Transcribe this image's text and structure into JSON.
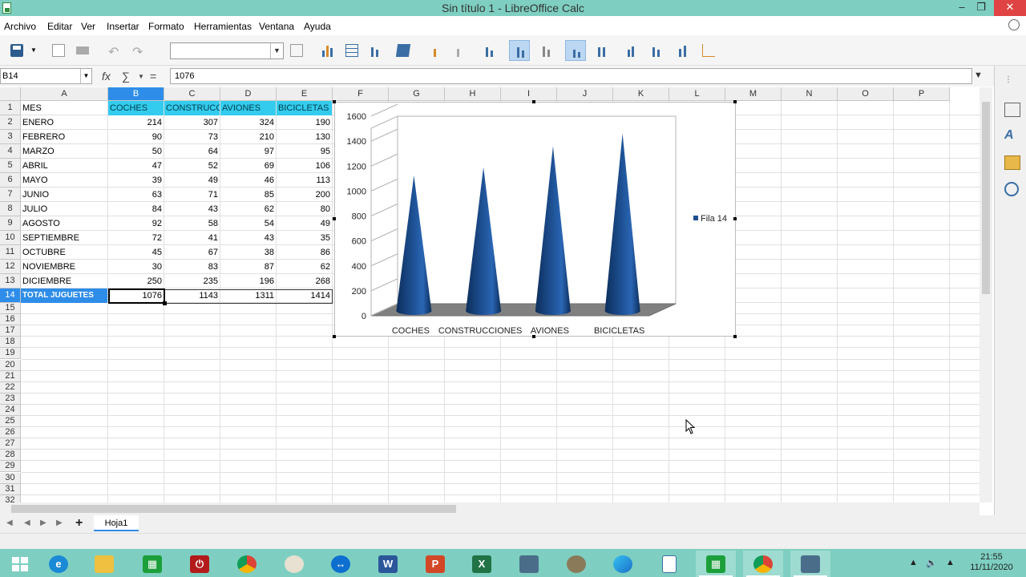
{
  "window": {
    "title": "Sin título 1 - LibreOffice Calc"
  },
  "menu": [
    "Archivo",
    "Editar",
    "Ver",
    "Insertar",
    "Formato",
    "Herramientas",
    "Ventana",
    "Ayuda"
  ],
  "formula": {
    "cell_ref": "B14",
    "value": "1076"
  },
  "columns": [
    "A",
    "B",
    "C",
    "D",
    "E",
    "F",
    "G",
    "H",
    "I",
    "J",
    "K",
    "L",
    "M",
    "N",
    "O",
    "P"
  ],
  "rows": [
    "1",
    "2",
    "3",
    "4",
    "5",
    "6",
    "7",
    "8",
    "9",
    "10",
    "11",
    "12",
    "13",
    "14",
    "15",
    "16",
    "17",
    "18",
    "19",
    "20",
    "21",
    "22",
    "23",
    "24",
    "25",
    "26",
    "27",
    "28",
    "29",
    "30",
    "31",
    "32"
  ],
  "sheet": {
    "header": [
      "MES",
      "COCHES",
      "CONSTRUCCI",
      "AVIONES",
      "BICICLETAS"
    ],
    "data": [
      [
        "ENERO",
        "214",
        "307",
        "324",
        "190"
      ],
      [
        "FEBRERO",
        "90",
        "73",
        "210",
        "130"
      ],
      [
        "MARZO",
        "50",
        "64",
        "97",
        "95"
      ],
      [
        "ABRIL",
        "47",
        "52",
        "69",
        "106"
      ],
      [
        "MAYO",
        "39",
        "49",
        "46",
        "113"
      ],
      [
        "JUNIO",
        "63",
        "71",
        "85",
        "200"
      ],
      [
        "JULIO",
        "84",
        "43",
        "62",
        "80"
      ],
      [
        "AGOSTO",
        "92",
        "58",
        "54",
        "49"
      ],
      [
        "SEPTIEMBRE",
        "72",
        "41",
        "43",
        "35"
      ],
      [
        "OCTUBRE",
        "45",
        "67",
        "38",
        "86"
      ],
      [
        "NOVIEMBRE",
        "30",
        "83",
        "87",
        "62"
      ],
      [
        "DICIEMBRE",
        "250",
        "235",
        "196",
        "268"
      ]
    ],
    "total": [
      "TOTAL JUGUETES",
      "1076",
      "1143",
      "1311",
      "1414"
    ]
  },
  "chart_data": {
    "type": "bar",
    "style": "3d-cone",
    "categories": [
      "COCHES",
      "CONSTRUCCIONES",
      "AVIONES",
      "BICICLETAS"
    ],
    "series": [
      {
        "name": "Fila 14",
        "values": [
          1076,
          1143,
          1311,
          1414
        ]
      }
    ],
    "ylim": [
      0,
      1600
    ],
    "yticks": [
      "0",
      "200",
      "400",
      "600",
      "800",
      "1000",
      "1200",
      "1400",
      "1600"
    ],
    "legend": "right",
    "color": "#1d4f91"
  },
  "tabs": {
    "sheet_name": "Hoja1"
  },
  "taskbar": {
    "time": "21:55",
    "date": "11/11/2020"
  },
  "icons": {
    "taskbar": [
      "windows-start-icon",
      "internet-explorer-icon",
      "file-explorer-icon",
      "libreoffice-calc-icon",
      "power-icon",
      "chrome-icon",
      "paint-icon",
      "teamviewer-icon",
      "word-icon",
      "powerpoint-icon",
      "excel-icon",
      "mediaviewer-icon",
      "gimp-icon",
      "edge-icon",
      "document-icon",
      "calc-running-icon",
      "chrome-running-icon",
      "mediaviewer-running-icon"
    ]
  },
  "colors": {
    "accent": "#2e8de8",
    "header_fill": "#33ccee",
    "titlebar": "#7ecfc1"
  }
}
